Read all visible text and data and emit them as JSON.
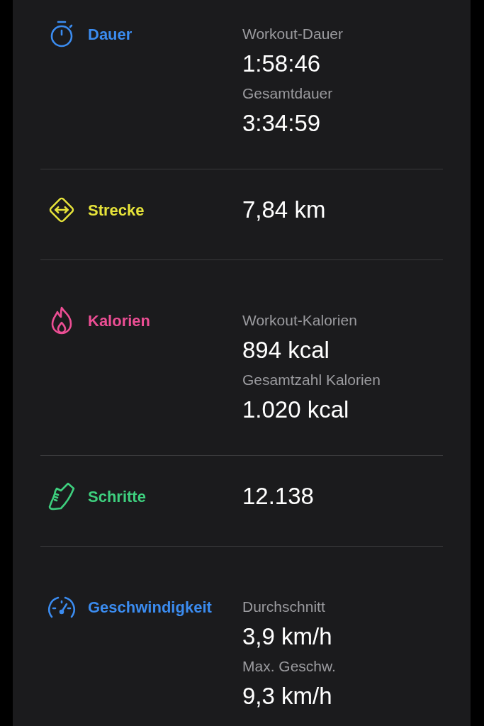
{
  "sections": [
    {
      "kind": "duration",
      "label": "Dauer",
      "color": "#3b8cf0",
      "values": [
        {
          "label": "Workout-Dauer",
          "value": "1:58:46"
        },
        {
          "label": "Gesamtdauer",
          "value": "3:34:59"
        }
      ]
    },
    {
      "kind": "distance",
      "label": "Strecke",
      "color": "#e6e33a",
      "values": [
        {
          "value": "7,84 km"
        }
      ]
    },
    {
      "kind": "calories",
      "label": "Kalorien",
      "color": "#ec4e94",
      "values": [
        {
          "label": "Workout-Kalorien",
          "value": "894 kcal"
        },
        {
          "label": "Gesamtzahl Kalorien",
          "value": "1.020 kcal"
        }
      ]
    },
    {
      "kind": "steps",
      "label": "Schritte",
      "color": "#3ecf7e",
      "values": [
        {
          "value": "12.138"
        }
      ]
    },
    {
      "kind": "speed",
      "label": "Geschwindigkeit",
      "color": "#3b8cf0",
      "values": [
        {
          "label": "Durchschnitt",
          "value": "3,9 km/h"
        },
        {
          "label": "Max. Geschw.",
          "value": "9,3 km/h"
        }
      ]
    }
  ]
}
